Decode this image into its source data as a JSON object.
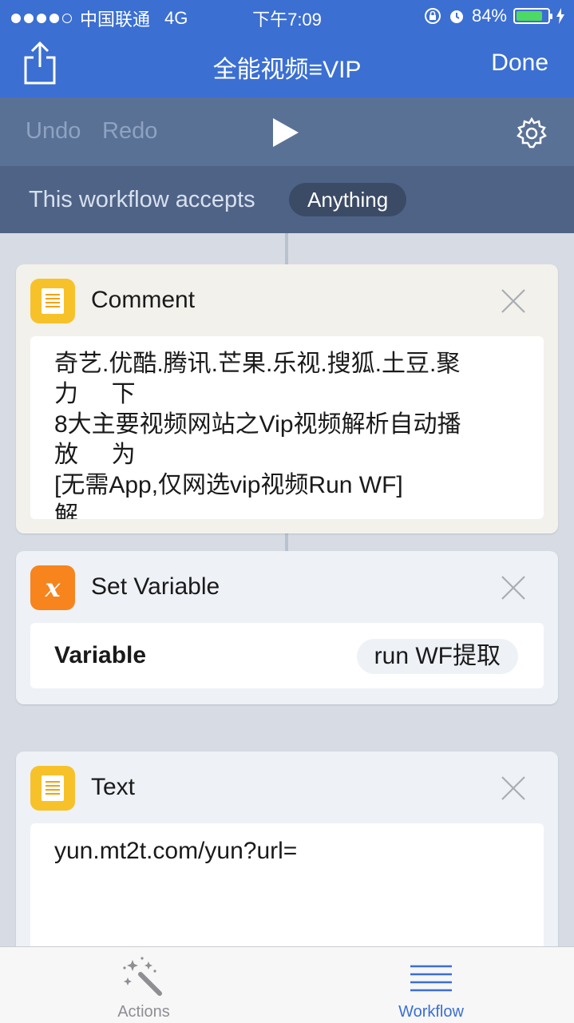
{
  "status_bar": {
    "carrier": "中国联通",
    "network": "4G",
    "time": "下午7:09",
    "battery": "84%",
    "battery_level": 0.84
  },
  "navbar": {
    "title": "全能视频≡VIP",
    "done_label": "Done",
    "share_icon": "share-icon"
  },
  "toolbar": {
    "undo_label": "Undo",
    "redo_label": "Redo",
    "play_icon": "play-icon",
    "settings_icon": "gear-icon"
  },
  "accepts": {
    "label": "This workflow accepts",
    "value": "Anything"
  },
  "actions": [
    {
      "type": "Comment",
      "title": "Comment",
      "icon": "note-icon",
      "text": "奇艺.优酷.腾讯.芒果.乐视.搜狐.土豆.聚\n力     下\n8大主要视频网站之Vip视频解析自动播\n放     为\n[无需App,仅网选vip视频Run WF]\n解"
    },
    {
      "type": "Set Variable",
      "title": "Set Variable",
      "icon": "variable-icon",
      "variable_label": "Variable",
      "variable_value": "run WF提取"
    },
    {
      "type": "Text",
      "title": "Text",
      "icon": "note-icon",
      "text": "yun.mt2t.com/yun?url="
    }
  ],
  "tabbar": {
    "actions_label": "Actions",
    "workflow_label": "Workflow",
    "active": "Workflow"
  },
  "colors": {
    "nav_blue": "#3b6fd2",
    "toolbar": "#5a7196",
    "accepts_bar": "#4e6386",
    "icon_yellow": "#f7c229",
    "icon_orange": "#f7841d"
  }
}
